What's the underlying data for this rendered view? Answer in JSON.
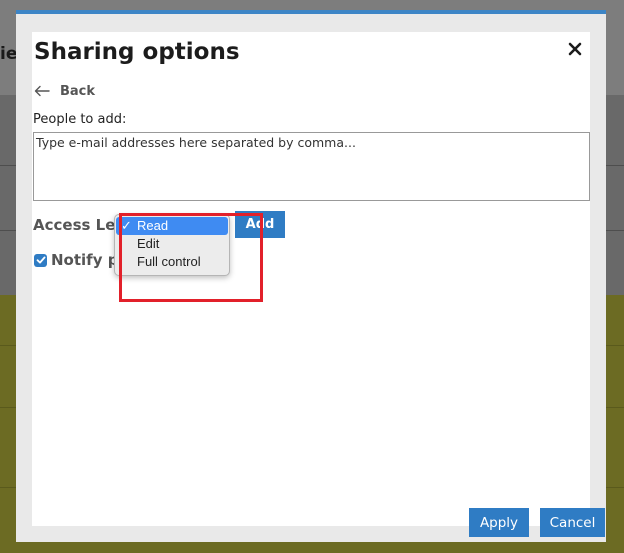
{
  "background": {
    "partial_text": "ies"
  },
  "dialog": {
    "title": "Sharing options",
    "back_label": "Back",
    "people_label": "People to add:",
    "email_placeholder": "Type e-mail addresses here separated by comma...",
    "access_level_label": "Access Leve",
    "add_label": "Add",
    "notify_label": "Notify pe",
    "notify_checked": true,
    "apply_label": "Apply",
    "cancel_label": "Cancel"
  },
  "access_dropdown": {
    "selected": "Read",
    "check_mark": "✓",
    "options": [
      "Read",
      "Edit",
      "Full control"
    ]
  },
  "colors": {
    "accent": "#2f7cc4",
    "modal_top_border": "#3d85c6",
    "dropdown_selected": "#3f8bf2",
    "highlight": "#e2202a"
  },
  "icons": {
    "close": "close-icon",
    "back": "arrow-left-icon",
    "check": "check-icon"
  }
}
